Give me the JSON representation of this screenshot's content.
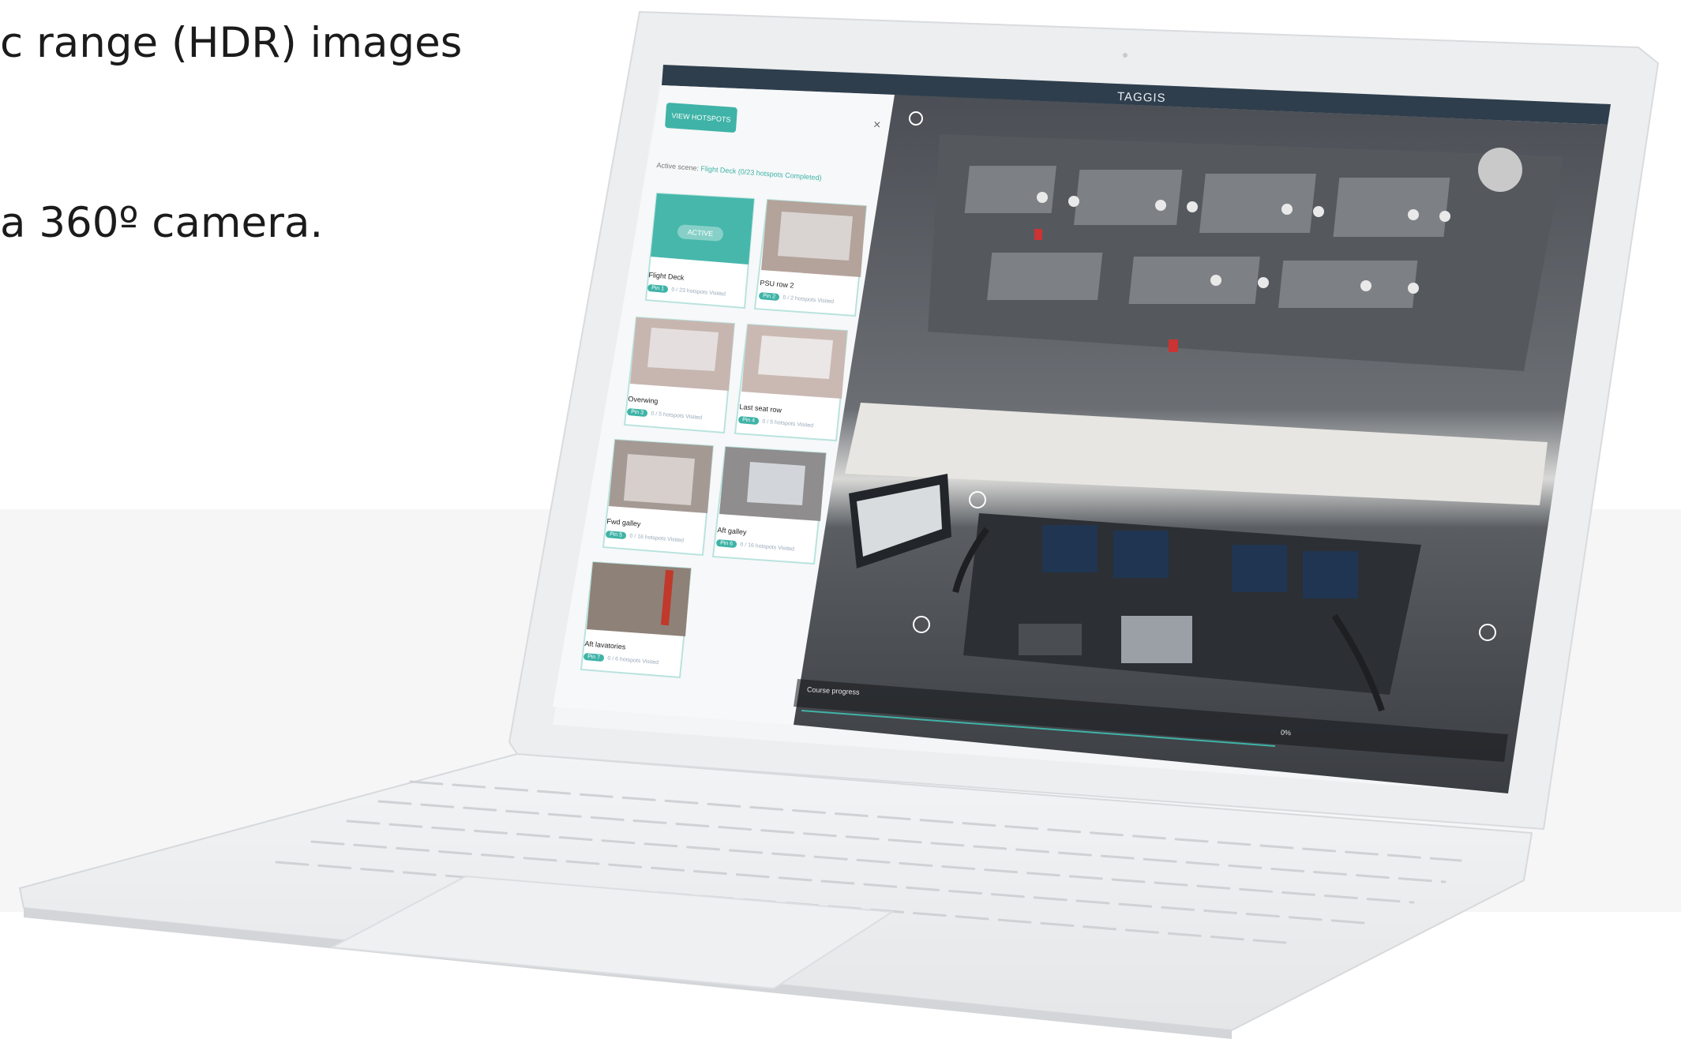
{
  "hero": {
    "line1": "c range (HDR) images",
    "line2": "a 360º camera."
  },
  "app": {
    "logo": "TAGGIS",
    "view_hotspots_label": "VIEW HOTSPOTS",
    "close_label": "×",
    "active_scene_prefix": "Active scene:",
    "active_scene_value": "Flight Deck (0/23 hotspots Completed)",
    "active_badge": "ACTIVE",
    "course_progress_label": "Course progress",
    "course_progress_percent": "0%"
  },
  "scenes": [
    {
      "title": "Flight Deck",
      "badge": "Pin 1",
      "sub": "0 / 23 hotspots Visited"
    },
    {
      "title": "PSU row 2",
      "badge": "Pin 2",
      "sub": "0 / 2 hotspots Visited"
    },
    {
      "title": "Overwing",
      "badge": "Pin 3",
      "sub": "0 / 5 hotspots Visited"
    },
    {
      "title": "Last seat row",
      "badge": "Pin 4",
      "sub": "0 / 5 hotspots Visited"
    },
    {
      "title": "Fwd galley",
      "badge": "Pin 5",
      "sub": "0 / 16 hotspots Visited"
    },
    {
      "title": "Aft galley",
      "badge": "Pin 6",
      "sub": "0 / 16 hotspots Visited"
    },
    {
      "title": "Aft lavatories",
      "badge": "Pin 7",
      "sub": "0 / 6 hotspots Visited"
    }
  ],
  "colors": {
    "accent": "#3fb3a7",
    "header_bar": "#2f3e4d",
    "laptop_body": "#eceeef"
  }
}
